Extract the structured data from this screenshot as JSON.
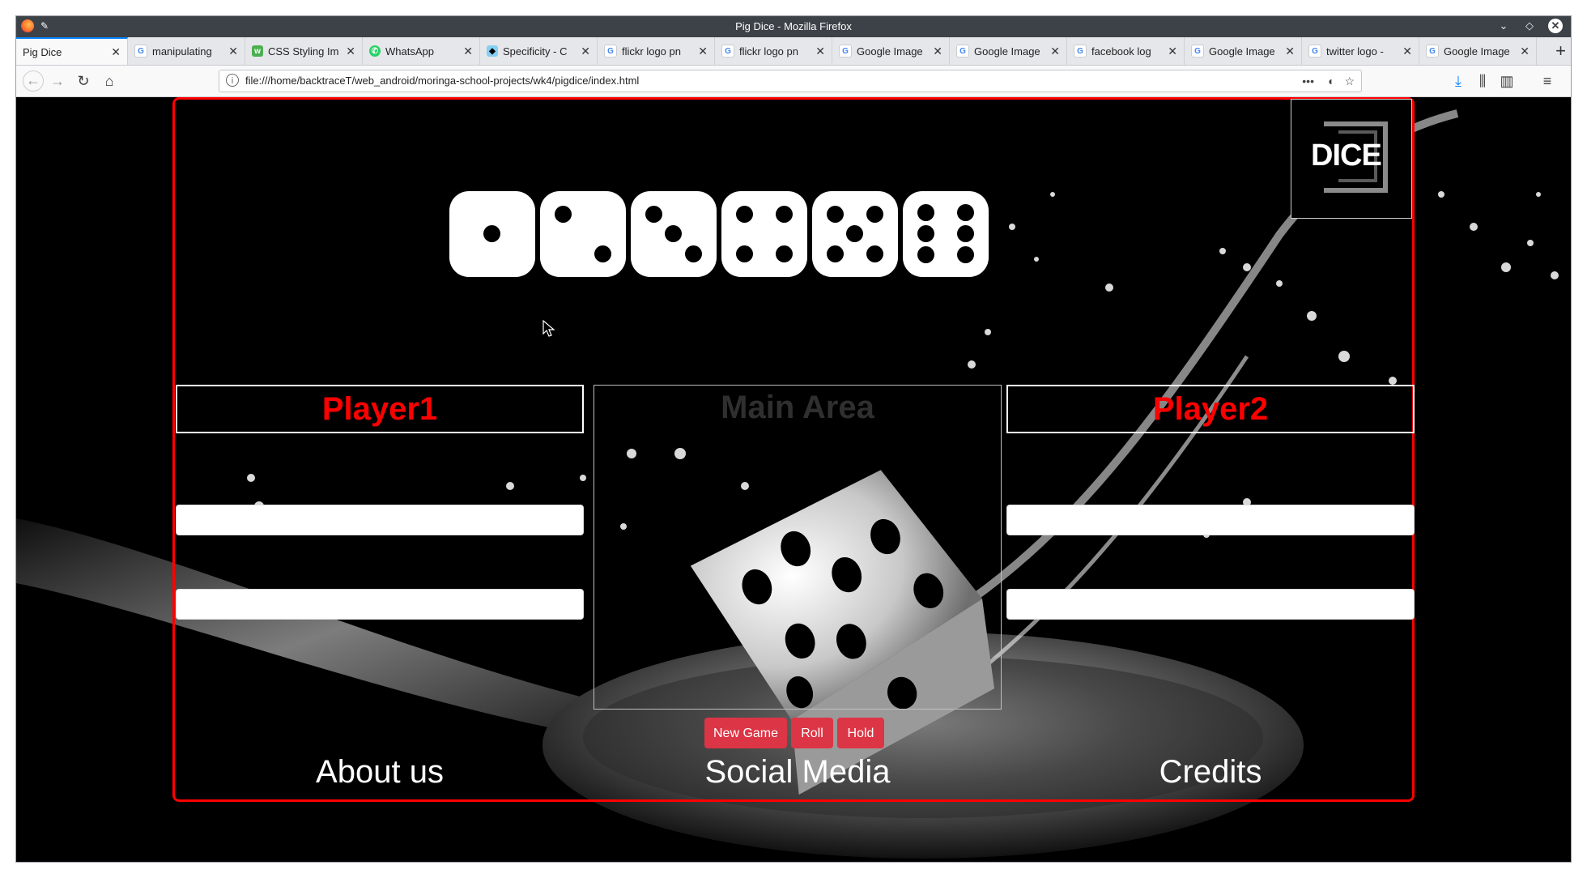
{
  "window": {
    "title": "Pig Dice - Mozilla Firefox"
  },
  "tabs": [
    {
      "label": "Pig Dice",
      "icon": "none",
      "active": true
    },
    {
      "label": "manipulating",
      "icon": "google-icon"
    },
    {
      "label": "CSS Styling Im",
      "icon": "w3schools-icon"
    },
    {
      "label": "WhatsApp",
      "icon": "whatsapp-icon"
    },
    {
      "label": "Specificity - C",
      "icon": "mdn-icon"
    },
    {
      "label": "flickr logo pn",
      "icon": "google-icon"
    },
    {
      "label": "flickr logo pn",
      "icon": "google-icon"
    },
    {
      "label": "Google Image",
      "icon": "google-icon"
    },
    {
      "label": "Google Image",
      "icon": "google-icon"
    },
    {
      "label": "facebook log",
      "icon": "google-icon"
    },
    {
      "label": "Google Image",
      "icon": "google-icon"
    },
    {
      "label": "twitter logo -",
      "icon": "google-icon"
    },
    {
      "label": "Google Image",
      "icon": "google-icon"
    }
  ],
  "navbar": {
    "url": "file:///home/backtraceT/web_android/moringa-school-projects/wk4/pigdice/index.html"
  },
  "page": {
    "logo_text": "DICE",
    "dice_faces": [
      1,
      2,
      3,
      4,
      5,
      6
    ],
    "player1": "Player1",
    "player2": "Player2",
    "main_area": "Main Area",
    "buttons": {
      "new_game": "New Game",
      "roll": "Roll",
      "hold": "Hold"
    },
    "footer": {
      "about": "About us",
      "social": "Social Media",
      "credits": "Credits"
    }
  },
  "colors": {
    "accent": "#ff0000",
    "button": "#dc3545",
    "tab_highlight": "#0a84ff"
  }
}
